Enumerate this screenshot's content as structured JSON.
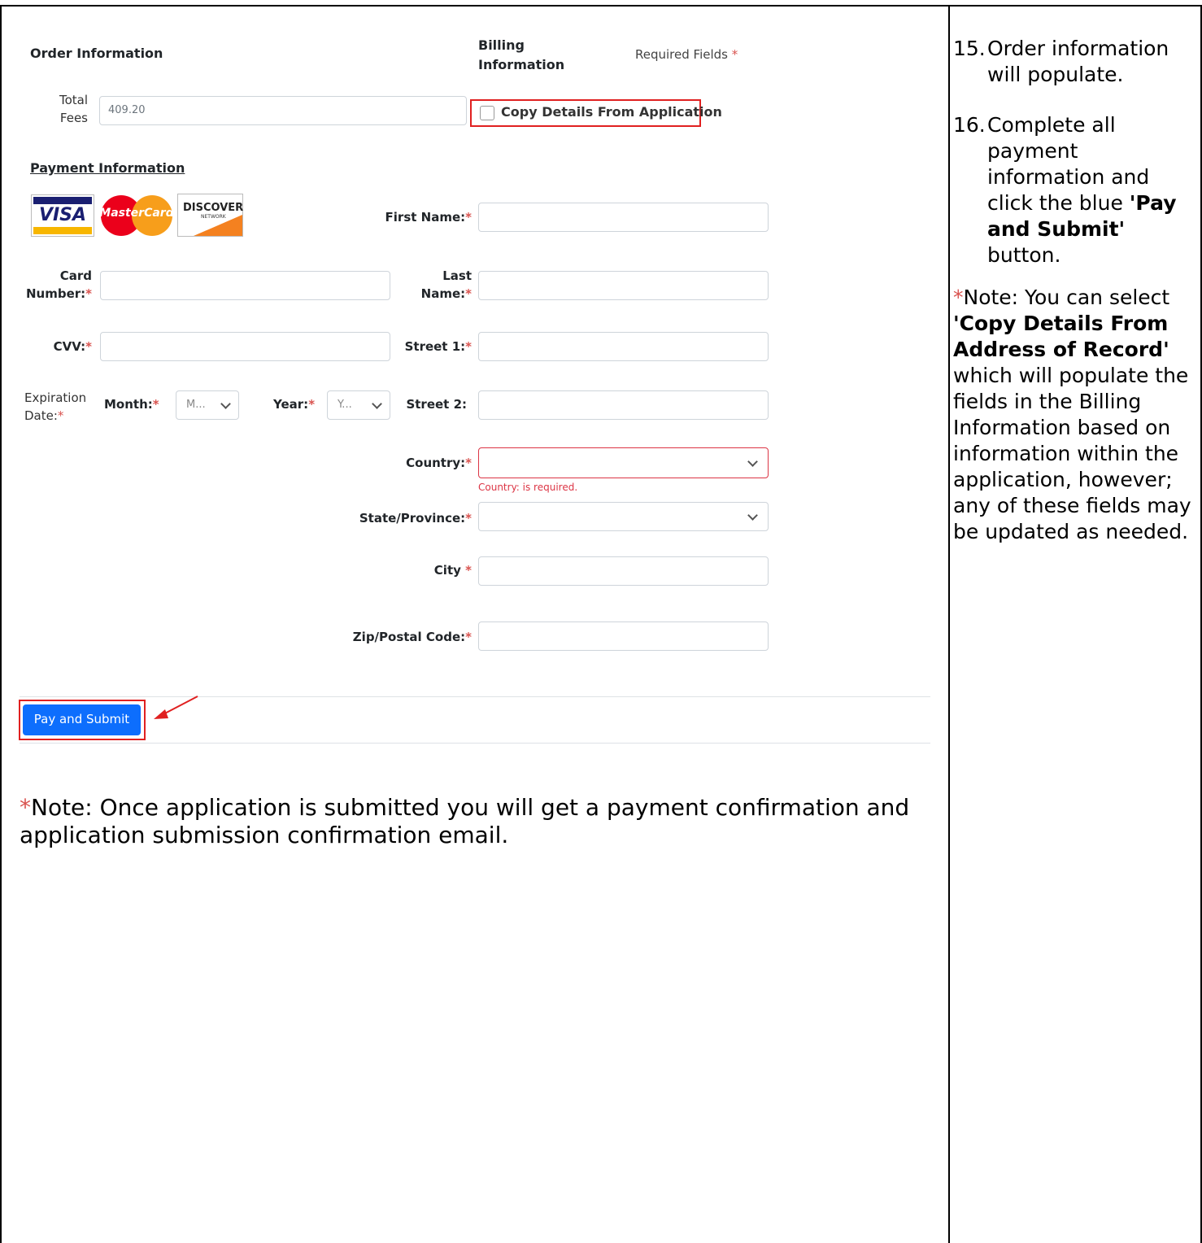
{
  "order": {
    "heading": "Order Information",
    "total_fees_label": "Total\nFees",
    "total_fees_value": "409.20"
  },
  "billing": {
    "heading": "Billing\nInformation",
    "required_fields": "Required Fields",
    "copy_details_label": "Copy Details From Application",
    "first_name_label": "First Name:",
    "last_name_label": "Last\nName:",
    "street1_label": "Street 1:",
    "street2_label": "Street 2:",
    "country_label": "Country:",
    "country_error": "Country: is required.",
    "state_label": "State/Province:",
    "city_label": "City",
    "zip_label": "Zip/Postal Code:"
  },
  "payment": {
    "heading": "Payment Information",
    "cards": [
      "VISA",
      "MasterCard",
      "DISCOVER"
    ],
    "discover_sub": "NETWORK",
    "card_number_label": "Card\nNumber:",
    "cvv_label": "CVV:",
    "expiration_label": "Expiration\nDate:",
    "month_label": "Month:",
    "month_value": "M...",
    "year_label": "Year:",
    "year_value": "Y..."
  },
  "actions": {
    "pay_submit_label": "Pay and Submit"
  },
  "notes": {
    "asterisk": "*",
    "bottom_note": "Note: Once application is submitted you will get a payment confirmation and application submission confirmation email."
  },
  "instructions": {
    "step15_num": "15.",
    "step15_text": "Order information will populate.",
    "step16_num": "16.",
    "step16_pre": "Complete all payment information and click the blue",
    "step16_bold": "'Pay and Submit'",
    "step16_post": "button.",
    "note_pre": "Note: You can select",
    "note_bold": "'Copy Details From Address of Record'",
    "note_post": "which will populate the fields in the Billing Information based on information within the application, however; any of these fields may be updated as needed."
  },
  "colors": {
    "accent_red": "#e02020",
    "button_blue": "#0d6efd",
    "error_red": "#dc3545"
  }
}
